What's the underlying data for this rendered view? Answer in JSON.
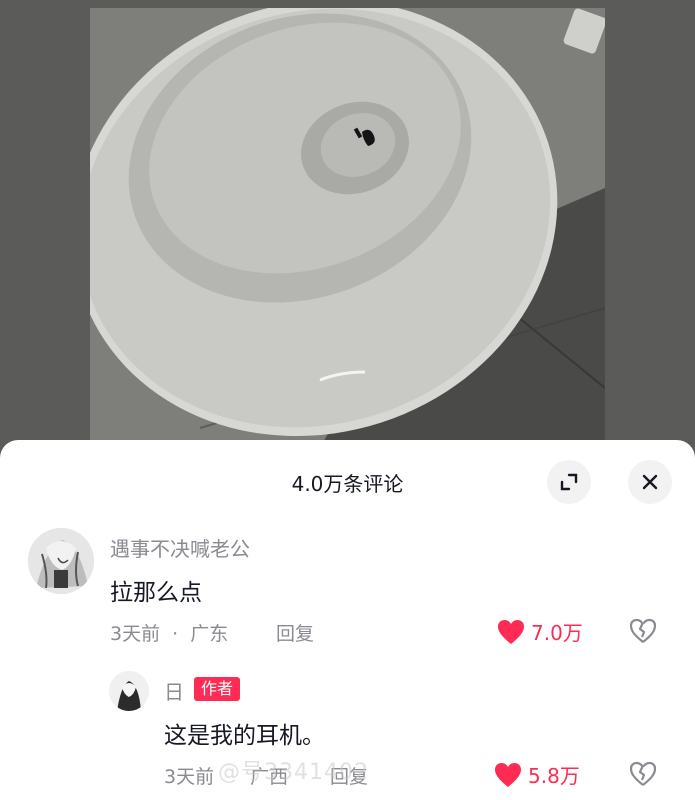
{
  "sheet": {
    "title": "4.0万条评论"
  },
  "comments": [
    {
      "username": "遇事不决喊老公",
      "text": "拉那么点",
      "time": "3天前",
      "separator": "·",
      "location": "广东",
      "reply_label": "回复",
      "likes": "7.0万"
    }
  ],
  "reply": {
    "username": "日",
    "badge": "作者",
    "text": "这是我的耳机。",
    "time": "3天前",
    "location": "广西",
    "reply_label": "回复",
    "likes": "5.8万"
  },
  "watermark": "@号3341402",
  "colors": {
    "like": "#fe2c55",
    "badge": "#fe2c55",
    "meta": "#8a8b91"
  },
  "icons": {
    "expand": "expand-icon",
    "close": "close-icon",
    "like": "heart-icon",
    "dislike": "broken-heart-icon"
  }
}
